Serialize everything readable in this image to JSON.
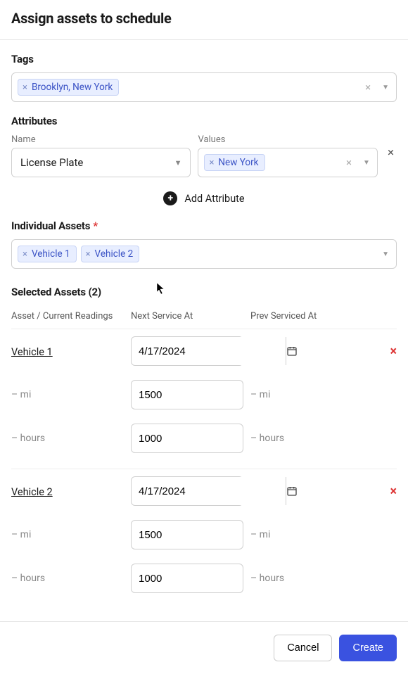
{
  "title": "Assign assets to schedule",
  "tags": {
    "label": "Tags",
    "items": [
      "Brooklyn, New York"
    ]
  },
  "attributes": {
    "label": "Attributes",
    "name_label": "Name",
    "values_label": "Values",
    "name_value": "License Plate",
    "value_chips": [
      "New York"
    ],
    "add_label": "Add Attribute"
  },
  "individual_assets": {
    "label": "Individual Assets",
    "chips": [
      "Vehicle 1",
      "Vehicle 2"
    ]
  },
  "selected": {
    "label": "Selected Assets (2)",
    "headers": {
      "col1": "Asset / Current Readings",
      "col2": "Next Service At",
      "col3": "Prev Serviced At"
    },
    "rows": [
      {
        "name": "Vehicle 1",
        "date": "4/17/2024",
        "mi_current": "– mi",
        "mi_next": "1500",
        "mi_prev": "– mi",
        "hours_current": "– hours",
        "hours_next": "1000",
        "hours_prev": "– hours"
      },
      {
        "name": "Vehicle 2",
        "date": "4/17/2024",
        "mi_current": "– mi",
        "mi_next": "1500",
        "mi_prev": "– mi",
        "hours_current": "– hours",
        "hours_next": "1000",
        "hours_prev": "– hours"
      }
    ]
  },
  "footer": {
    "cancel": "Cancel",
    "create": "Create"
  },
  "glyphs": {
    "x": "×",
    "caret": "▼",
    "plus": "+"
  }
}
